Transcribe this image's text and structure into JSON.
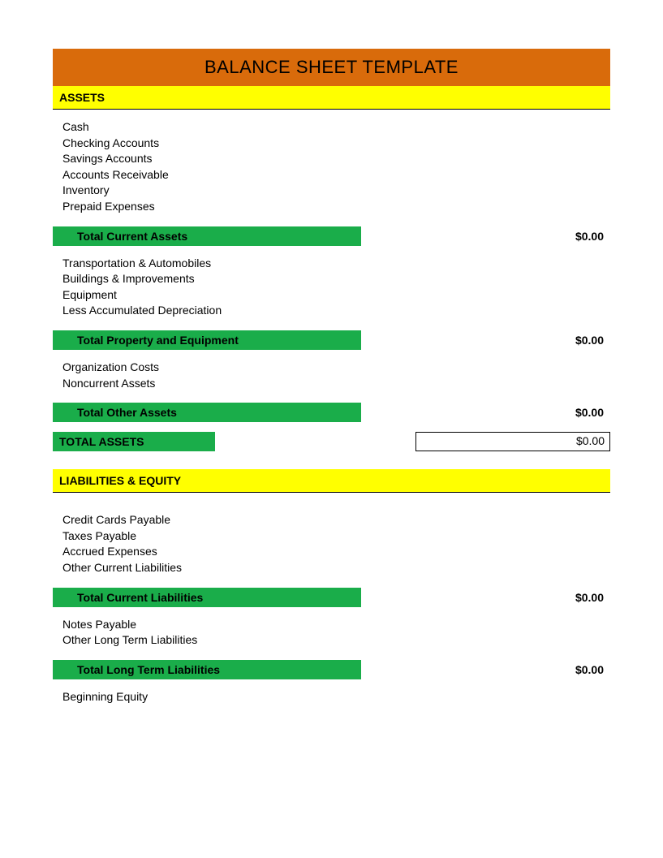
{
  "title": "BALANCE SHEET TEMPLATE",
  "sections": {
    "assets": {
      "header": "ASSETS",
      "current_items": [
        "Cash",
        "Checking Accounts",
        "Savings Accounts",
        "Accounts Receivable",
        "Inventory",
        "Prepaid Expenses"
      ],
      "current_total_label": "Total Current Assets",
      "current_total_value": "$0.00",
      "property_items": [
        "Transportation & Automobiles",
        "Buildings & Improvements",
        "Equipment",
        "Less Accumulated Depreciation"
      ],
      "property_total_label": "Total Property and Equipment",
      "property_total_value": "$0.00",
      "other_items": [
        "Organization Costs",
        "Noncurrent Assets"
      ],
      "other_total_label": "Total Other Assets",
      "other_total_value": "$0.00",
      "grand_label": "TOTAL ASSETS",
      "grand_value": "$0.00"
    },
    "liabilities": {
      "header": "LIABILITIES & EQUITY",
      "current_items": [
        "Credit Cards Payable",
        "Taxes Payable",
        "Accrued Expenses",
        "Other Current Liabilities"
      ],
      "current_total_label": "Total Current Liabilities",
      "current_total_value": "$0.00",
      "longterm_items": [
        "Notes Payable",
        "Other Long Term Liabilities"
      ],
      "longterm_total_label": "Total Long Term Liabilities",
      "longterm_total_value": "$0.00",
      "equity_items": [
        "Beginning Equity"
      ]
    }
  },
  "chart_data": {
    "type": "table",
    "title": "Balance Sheet Template",
    "rows": [
      {
        "category": "Assets",
        "item": "Total Current Assets",
        "value": 0.0
      },
      {
        "category": "Assets",
        "item": "Total Property and Equipment",
        "value": 0.0
      },
      {
        "category": "Assets",
        "item": "Total Other Assets",
        "value": 0.0
      },
      {
        "category": "Assets",
        "item": "TOTAL ASSETS",
        "value": 0.0
      },
      {
        "category": "Liabilities & Equity",
        "item": "Total Current Liabilities",
        "value": 0.0
      },
      {
        "category": "Liabilities & Equity",
        "item": "Total Long Term Liabilities",
        "value": 0.0
      }
    ]
  }
}
